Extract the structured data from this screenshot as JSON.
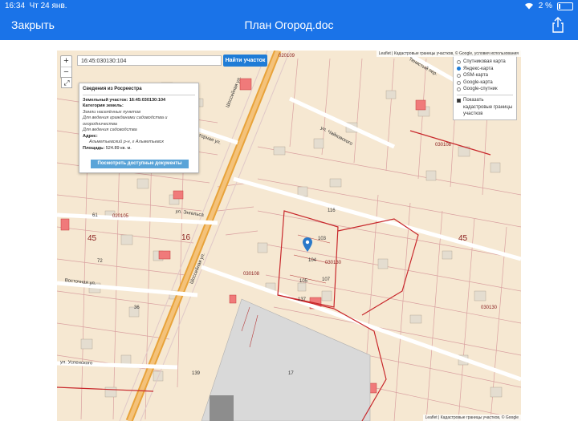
{
  "status": {
    "time": "16:34",
    "date": "Чт 24 янв.",
    "battery": "2 %"
  },
  "nav": {
    "close": "Закрыть",
    "title": "План Огород.doc"
  },
  "map": {
    "attribution_top": "Leaflet | Кадастровые границы участков, © Google, условия использования",
    "attribution_bottom": "Leaflet | Кадастровые границы участков, © Google",
    "search_value": "16:45:030130:104",
    "search_button": "Найти участок",
    "zoom_in": "+",
    "zoom_out": "−",
    "fullscreen": "⤢",
    "info": {
      "header": "Сведения из Росреестра",
      "parcel": "Земельный участок: 16:45:030130:104",
      "category_label": "Категория земель:",
      "category_value": "Земли населённых пунктов",
      "use1": "Для ведения гражданами садоводства и огородничества",
      "use2": "Для ведения садоводства",
      "address_label": "Адрес:",
      "address_value": "Альметьевский р-н, г Альметьевск",
      "area_label": "Площадь:",
      "area_value": "524.89 кв. м.",
      "docs_button": "Посмотреть доступные документы"
    },
    "layers": {
      "satellite": "Спутниковая карта",
      "yandex": "Яндекс-карта",
      "osm": "OSM-карта",
      "google": "Google-карта",
      "google_sat": "Google-спутник",
      "cadastre": "Показать кадастровые границы участков"
    },
    "streets": {
      "shosse1": "Шоссейная ул.",
      "shosse2": "Шоссейная ул.",
      "engels": "ул. Энгельса",
      "vostochnaya": "Восточная ул.",
      "uspenskogo": "ул. Успенского",
      "chaikovskogo": "ул. Чайковского",
      "ambulatornaya": "Амбулаторная ул.",
      "tupik": "Тенистый пер."
    },
    "labels": {
      "q1": "020109",
      "q2": "030108",
      "q3": "020105",
      "q4": "030108",
      "q5": "030130",
      "q6": "030130",
      "big16": "16",
      "big45a": "45",
      "big45b": "45",
      "p104": "104",
      "p103": "103",
      "p105": "105",
      "p107": "107",
      "p137": "137",
      "p116": "116",
      "p61": "61",
      "p72": "72",
      "p36": "36",
      "p139": "139",
      "p17": "17"
    }
  }
}
